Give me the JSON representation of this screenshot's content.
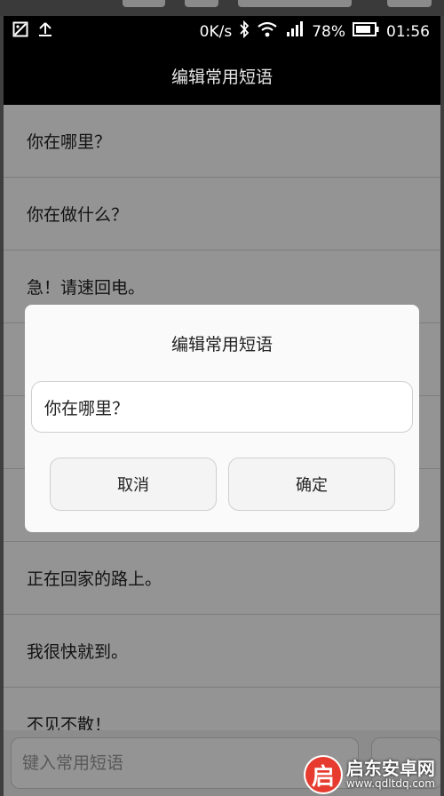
{
  "status_bar": {
    "speed": "0K/s",
    "battery": "78%",
    "time": "01:56",
    "icons": [
      "image-icon",
      "upload-icon",
      "bluetooth-icon",
      "wifi-icon",
      "signal-icon",
      "battery-icon"
    ]
  },
  "header": {
    "title": "编辑常用短语"
  },
  "list": {
    "items": [
      "你在哪里？",
      "你在做什么？",
      "急！请速回电。",
      "",
      "",
      "",
      "正在回家的路上。",
      "我很快就到。",
      "不见不散！"
    ]
  },
  "input_bar": {
    "placeholder": "键入常用短语"
  },
  "dialog": {
    "title": "编辑常用短语",
    "input_value": "你在哪里？",
    "cancel_label": "取消",
    "confirm_label": "确定"
  },
  "watermark": {
    "logo_glyph": "启",
    "name": "启东安卓网",
    "url": "www.qdltdq.com"
  },
  "colors": {
    "header_bg": "#000000",
    "overlay": "rgba(0,0,0,0.42)",
    "watermark_red": "#e63b2e"
  }
}
